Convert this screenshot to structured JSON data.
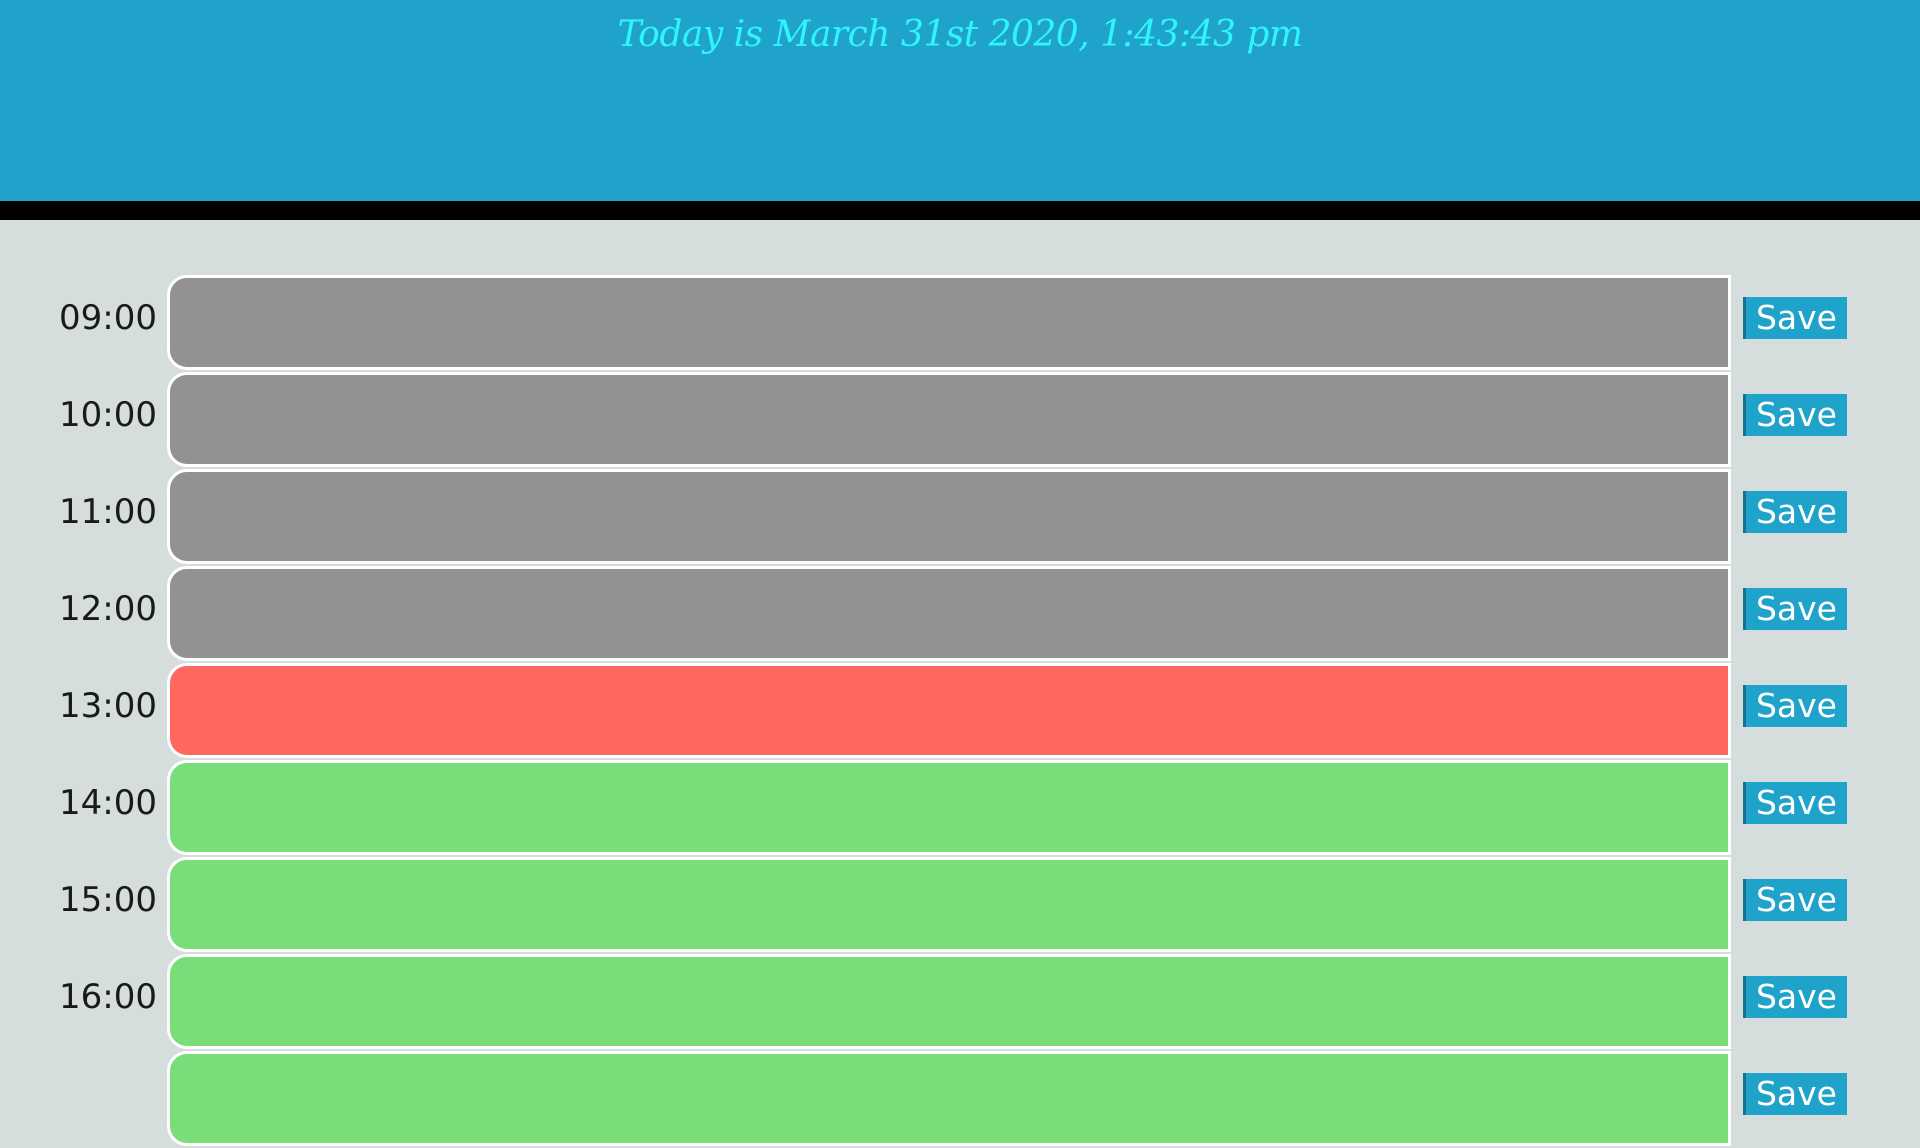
{
  "header": {
    "date_text": "Today is March 31st 2020, 1:43:43 pm"
  },
  "colors": {
    "header_bg": "#1fa3ca",
    "date_text": "#2ff4ff",
    "past": "#929292",
    "present": "#ff6861",
    "future": "#79dd79",
    "page_bg": "#d5dddd"
  },
  "rows": [
    {
      "hour": "09:00",
      "state": "past",
      "value": "",
      "save_label": "Save"
    },
    {
      "hour": "10:00",
      "state": "past",
      "value": "",
      "save_label": "Save"
    },
    {
      "hour": "11:00",
      "state": "past",
      "value": "",
      "save_label": "Save"
    },
    {
      "hour": "12:00",
      "state": "past",
      "value": "",
      "save_label": "Save"
    },
    {
      "hour": "13:00",
      "state": "present",
      "value": "",
      "save_label": "Save"
    },
    {
      "hour": "14:00",
      "state": "future",
      "value": "",
      "save_label": "Save"
    },
    {
      "hour": "15:00",
      "state": "future",
      "value": "",
      "save_label": "Save"
    },
    {
      "hour": "16:00",
      "state": "future",
      "value": "",
      "save_label": "Save"
    },
    {
      "hour": "",
      "state": "future",
      "value": "",
      "save_label": "Save"
    }
  ]
}
